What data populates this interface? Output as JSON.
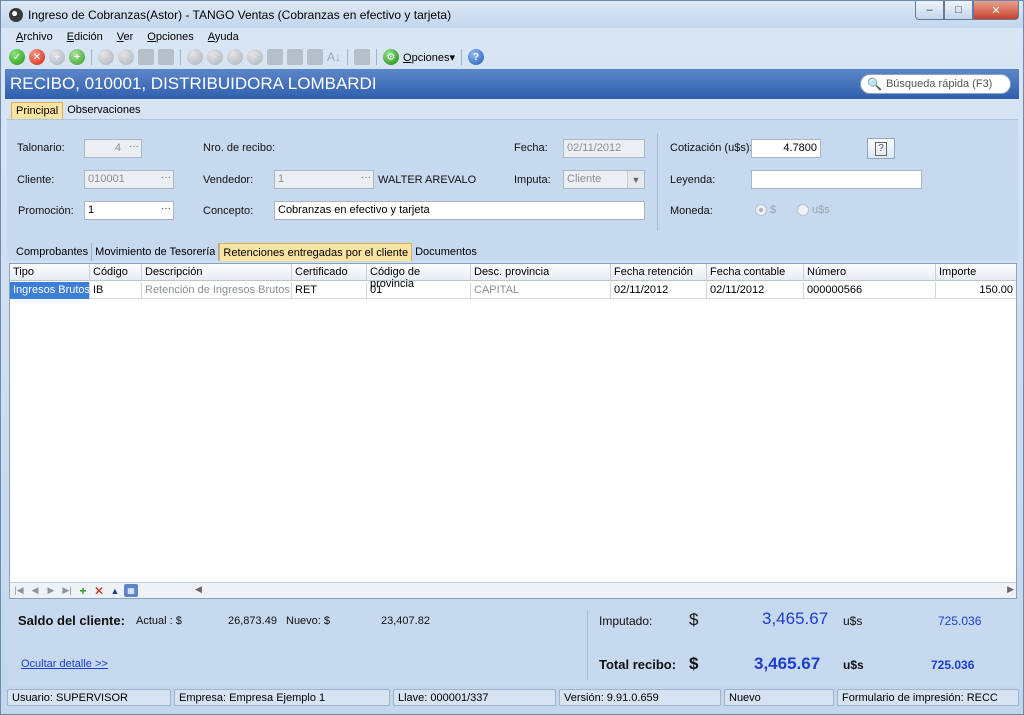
{
  "window": {
    "title": "Ingreso de Cobranzas(Astor) - TANGO Ventas (Cobranzas en efectivo y tarjeta)",
    "minimize": "–",
    "maximize": "□",
    "close": "✕"
  },
  "menu": [
    {
      "key": "A",
      "rest": "rchivo"
    },
    {
      "key": "E",
      "rest": "dición"
    },
    {
      "key": "V",
      "rest": "er"
    },
    {
      "key": "O",
      "rest": "pciones"
    },
    {
      "key": "A",
      "rest": "yuda"
    }
  ],
  "toolbar": {
    "options_key": "O",
    "options_rest": "pciones",
    "options_arrow": "▾",
    "confirm_glyph": "✓",
    "cancel_glyph": "✕",
    "add_glyph": "+",
    "add_item_glyph": "+",
    "help_glyph": "?",
    "options_glyph": "⚙",
    "sort_glyph": "A↓"
  },
  "header": {
    "title": "RECIBO,  010001, DISTRIBUIDORA LOMBARDI",
    "search_placeholder": "Búsqueda rápida (F3)",
    "search_icon": "🔍"
  },
  "main_tabs": [
    "Principal",
    "Observaciones"
  ],
  "form": {
    "talonario_label": "Talonario:",
    "talonario_value": "4",
    "nro_recibo_label": "Nro. de recibo:",
    "fecha_label": "Fecha:",
    "fecha_value": "02/11/2012",
    "cotizacion_label": "Cotización (u$s):",
    "cotizacion_value": "4.7800",
    "cliente_label": "Cliente:",
    "cliente_value": "010001",
    "vendedor_label": "Vendedor:",
    "vendedor_value": "1",
    "vendedor_name": "WALTER AREVALO",
    "imputa_label": "Imputa:",
    "imputa_value": "Cliente",
    "leyenda_label": "Leyenda:",
    "leyenda_value": "",
    "promocion_label": "Promoción:",
    "promocion_value": "1",
    "concepto_label": "Concepto:",
    "concepto_value": "Cobranzas en efectivo y tarjeta",
    "moneda_label": "Moneda:",
    "moneda_options": [
      "$",
      "u$s"
    ],
    "dots": "···",
    "help_glyph": "?"
  },
  "sub_tabs": [
    "Comprobantes",
    "Movimiento de Tesorería",
    "Retenciones entregadas por el cliente",
    "Documentos"
  ],
  "grid": {
    "columns": [
      "Tipo",
      "Código",
      "Descripción",
      "Certificado",
      "Código de provincia",
      "Desc. provincia",
      "Fecha retención",
      "Fecha contable",
      "Número",
      "Importe"
    ],
    "rows": [
      [
        "Ingresos Brutos",
        "IB",
        "Retención de Ingresos Brutos",
        "RET",
        "01",
        "CAPITAL",
        "02/11/2012",
        "02/11/2012",
        "000000566",
        "150.00"
      ]
    ]
  },
  "summary": {
    "saldo_label": "Saldo del cliente:",
    "actual_label": "Actual : $",
    "actual_value": "26,873.49",
    "nuevo_label": "Nuevo: $",
    "nuevo_value": "23,407.82",
    "ocultar_link": "Ocultar detalle >>",
    "imputado_label": "Imputado:",
    "imputado_currency": "$",
    "imputado_value": "3,465.67",
    "imputado_usd_label": "u$s",
    "imputado_usd_value": "725.036",
    "total_label": "Total recibo:",
    "total_currency": "$",
    "total_value": "3,465.67",
    "total_usd_label": "u$s",
    "total_usd_value": "725.036"
  },
  "statusbar": [
    "Usuario: SUPERVISOR",
    "Empresa: Empresa Ejemplo 1",
    "Llave: 000001/337",
    "Versión: 9.91.0.659",
    "Nuevo",
    "Formulario de impresión: RECC"
  ]
}
